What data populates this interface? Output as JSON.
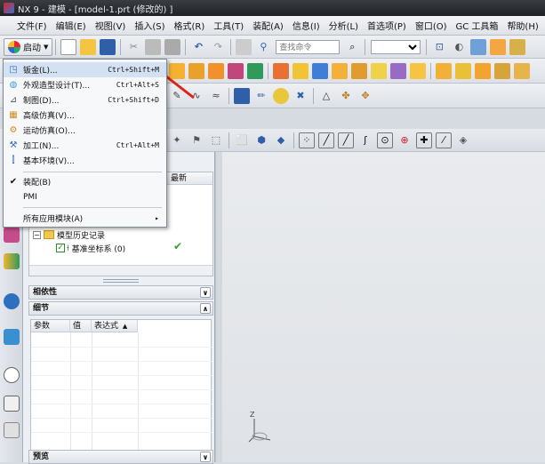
{
  "window": {
    "title": "NX 9 - 建模 - [model-1.prt  (修改的) ]"
  },
  "menubar": {
    "items": [
      "文件(F)",
      "编辑(E)",
      "视图(V)",
      "插入(S)",
      "格式(R)",
      "工具(T)",
      "装配(A)",
      "信息(I)",
      "分析(L)",
      "首选项(P)",
      "窗口(O)",
      "GC 工具箱",
      "帮助(H)"
    ]
  },
  "toolbar": {
    "start_label": "启动",
    "search_placeholder": "查找命令"
  },
  "start_menu": {
    "items": [
      {
        "label": "钣金(L)...",
        "shortcut": "Ctrl+Shift+M",
        "icon": "sheetmetal-icon"
      },
      {
        "label": "外观造型设计(T)...",
        "shortcut": "Ctrl+Alt+S",
        "icon": "shape-studio-icon"
      },
      {
        "label": "制图(D)...",
        "shortcut": "Ctrl+Shift+D",
        "icon": "drafting-icon"
      },
      {
        "label": "高级仿真(V)...",
        "shortcut": "",
        "icon": "advanced-simulation-icon"
      },
      {
        "label": "运动仿真(O)...",
        "shortcut": "",
        "icon": "motion-simulation-icon"
      },
      {
        "label": "加工(N)...",
        "shortcut": "Ctrl+Alt+M",
        "icon": "manufacturing-icon"
      },
      {
        "label": "基本环境(V)...",
        "shortcut": "",
        "icon": "gateway-icon"
      }
    ],
    "assembly_label": "装配(B)",
    "pmi_label": "PMI",
    "all_apps_label": "所有应用模块(A)"
  },
  "navigator": {
    "column_latest": "最新",
    "tree": [
      {
        "label": "模型历史记录"
      },
      {
        "label": "基准坐标系 (0)"
      }
    ]
  },
  "panels": {
    "dependencies": "相依性",
    "details": "细节",
    "preview": "预览"
  },
  "details_table": {
    "columns": [
      "参数",
      "值",
      "表达式"
    ]
  },
  "viewport": {
    "axis_label": "Z"
  },
  "colors": {
    "accent": "#2f6fc0",
    "arrow": "#e0231b",
    "check": "#2aa52a"
  }
}
